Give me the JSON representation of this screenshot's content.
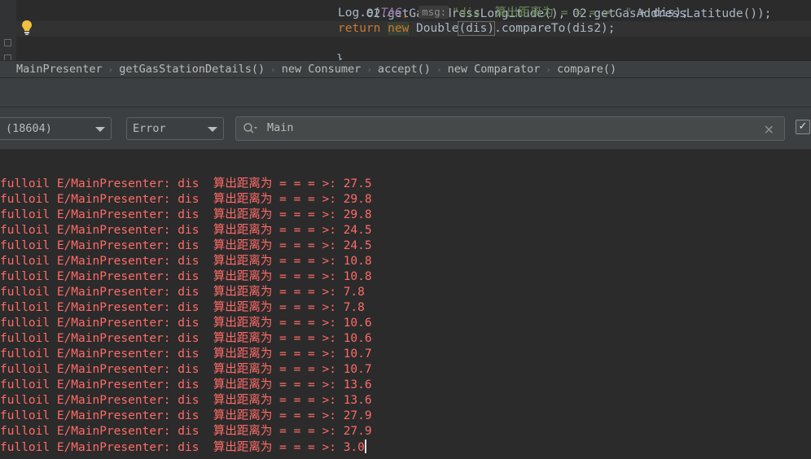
{
  "editor": {
    "line0": {
      "text": "O2.getGasAddressLongitude(), O2.getGasAddressLatitude());"
    },
    "line1": {
      "recv": "Log.",
      "method": "e",
      "open": "(",
      "tag": "TAG",
      "comma": ", ",
      "hint": "msg:",
      "str": "\"dis  算出距离为 = = = >: \"",
      "rest": " + dis);"
    },
    "line2": {
      "kw_return": "return",
      "kw_new": "new",
      "ctor": " Double",
      "arg": "(dis)",
      "call": ".",
      "compare": "compareTo",
      "end": "(dis2);"
    },
    "line3": {
      "text": "}"
    },
    "line4": {
      "text": "});"
    }
  },
  "breadcrumb": {
    "items": [
      "MainPresenter",
      "getGasStationDetails()",
      "new Consumer",
      "accept()",
      "new Comparator",
      "compare()"
    ]
  },
  "filter": {
    "process_value": "(18604)",
    "level_value": "Error",
    "search_value": "Main",
    "clear_glyph": "✕",
    "check_glyph": "✓"
  },
  "log": {
    "prefix": "fulloil E/MainPresenter: dis  算出距离为 = = = >: ",
    "values": [
      "27.5",
      "29.8",
      "29.8",
      "24.5",
      "24.5",
      "10.8",
      "10.8",
      "7.8",
      "7.8",
      "10.6",
      "10.6",
      "10.7",
      "10.7",
      "13.6",
      "13.6",
      "27.9",
      "27.9",
      "3.0"
    ]
  },
  "colors": {
    "error_text": "#ff6b68",
    "keyword": "#cc7832",
    "string": "#6a8759",
    "constant": "#9876aa",
    "bulb": "#f0c040"
  }
}
